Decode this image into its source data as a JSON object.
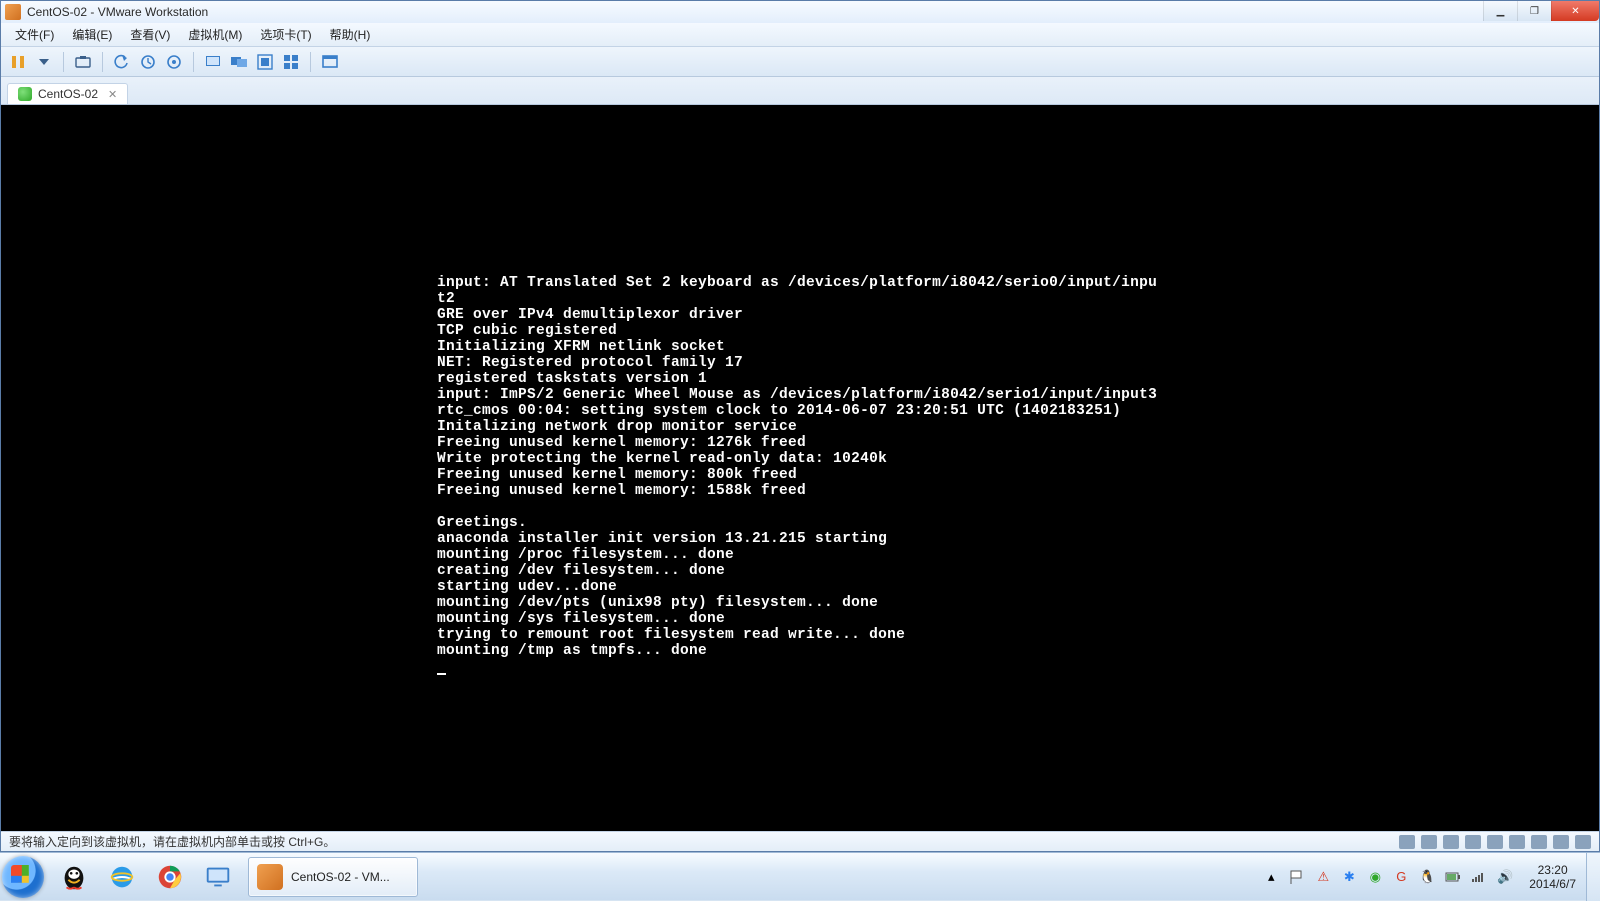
{
  "window": {
    "title": "CentOS-02 - VMware Workstation"
  },
  "menus": [
    "文件(F)",
    "编辑(E)",
    "查看(V)",
    "虚拟机(M)",
    "选项卡(T)",
    "帮助(H)"
  ],
  "tab": {
    "label": "CentOS-02"
  },
  "console_lines": [
    "input: AT Translated Set 2 keyboard as /devices/platform/i8042/serio0/input/inpu",
    "t2",
    "GRE over IPv4 demultiplexor driver",
    "TCP cubic registered",
    "Initializing XFRM netlink socket",
    "NET: Registered protocol family 17",
    "registered taskstats version 1",
    "input: ImPS/2 Generic Wheel Mouse as /devices/platform/i8042/serio1/input/input3",
    "rtc_cmos 00:04: setting system clock to 2014-06-07 23:20:51 UTC (1402183251)",
    "Initalizing network drop monitor service",
    "Freeing unused kernel memory: 1276k freed",
    "Write protecting the kernel read-only data: 10240k",
    "Freeing unused kernel memory: 800k freed",
    "Freeing unused kernel memory: 1588k freed",
    "",
    "Greetings.",
    "anaconda installer init version 13.21.215 starting",
    "mounting /proc filesystem... done",
    "creating /dev filesystem... done",
    "starting udev...done",
    "mounting /dev/pts (unix98 pty) filesystem... done",
    "mounting /sys filesystem... done",
    "trying to remount root filesystem read write... done",
    "mounting /tmp as tmpfs... done"
  ],
  "status": {
    "hint": "要将输入定向到该虚拟机，请在虚拟机内部单击或按 Ctrl+G。"
  },
  "taskbar": {
    "task_label": "CentOS-02 - VM...",
    "tray_time": "23:20",
    "tray_date": "2014/6/7"
  },
  "colors": {
    "console_fg": "#ffffff",
    "console_bg": "#000000"
  }
}
